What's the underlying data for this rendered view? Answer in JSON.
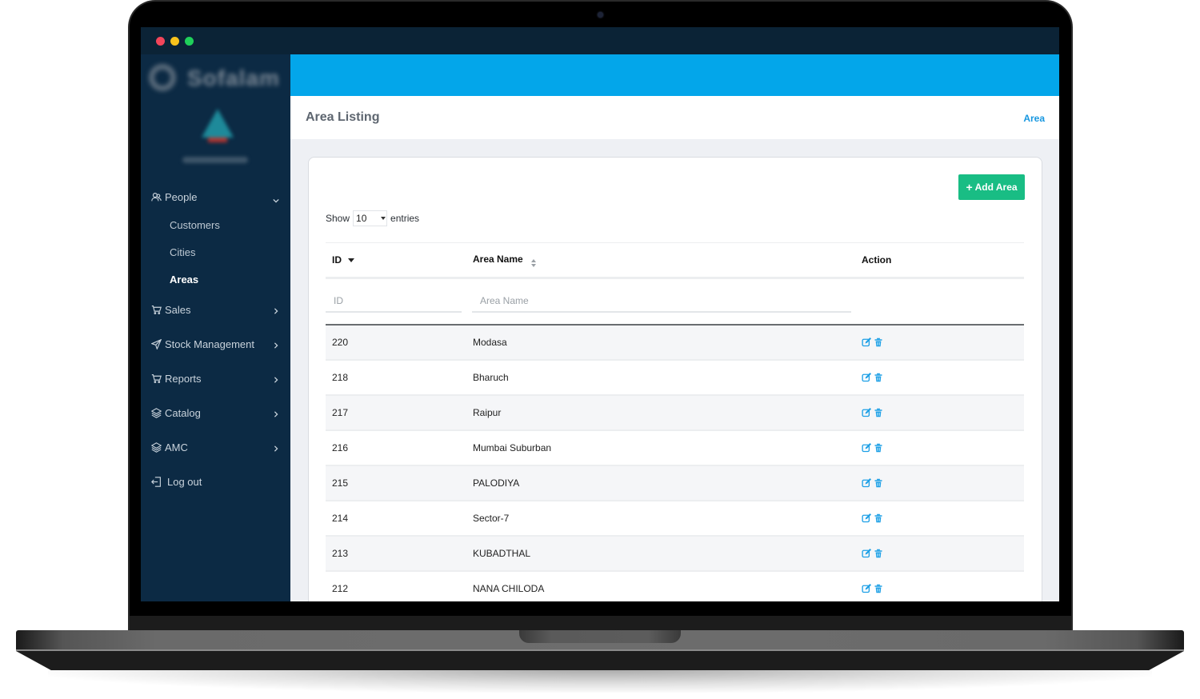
{
  "window": {
    "traffic_lights": [
      "close",
      "minimize",
      "maximize"
    ]
  },
  "sidebar": {
    "brand_text": "Sofalam",
    "nav": [
      {
        "label": "People",
        "icon": "users-icon",
        "expanded": true,
        "children": [
          {
            "label": "Customers",
            "active": false
          },
          {
            "label": "Cities",
            "active": false
          },
          {
            "label": "Areas",
            "active": true
          }
        ]
      },
      {
        "label": "Sales",
        "icon": "cart-icon"
      },
      {
        "label": "Stock Management",
        "icon": "paper-plane-icon"
      },
      {
        "label": "Reports",
        "icon": "cart-icon"
      },
      {
        "label": "Catalog",
        "icon": "layers-icon"
      },
      {
        "label": "AMC",
        "icon": "layers-icon"
      },
      {
        "label": "Log out",
        "icon": "logout-icon"
      }
    ]
  },
  "header": {
    "page_title": "Area Listing",
    "breadcrumb": "Area"
  },
  "colors": {
    "topbar": "#03a6ea",
    "sidebar": "#0c2a44",
    "add_button": "#19bd84",
    "action_icon": "#1ea0e6",
    "breadcrumb": "#1797e0"
  },
  "toolbar": {
    "add_label": "Add Area",
    "show_label": "Show",
    "entries_label": "entries",
    "page_length": "10",
    "page_length_options": [
      "10"
    ]
  },
  "table": {
    "columns": [
      "ID",
      "Area Name",
      "Action"
    ],
    "filters": {
      "id_placeholder": "ID",
      "name_placeholder": "Area Name"
    },
    "rows": [
      {
        "id": "220",
        "name": "Modasa"
      },
      {
        "id": "218",
        "name": "Bharuch"
      },
      {
        "id": "217",
        "name": "Raipur"
      },
      {
        "id": "216",
        "name": "Mumbai Suburban"
      },
      {
        "id": "215",
        "name": "PALODIYA"
      },
      {
        "id": "214",
        "name": "Sector-7"
      },
      {
        "id": "213",
        "name": "KUBADTHAL"
      },
      {
        "id": "212",
        "name": "NANA CHILODA"
      }
    ]
  }
}
